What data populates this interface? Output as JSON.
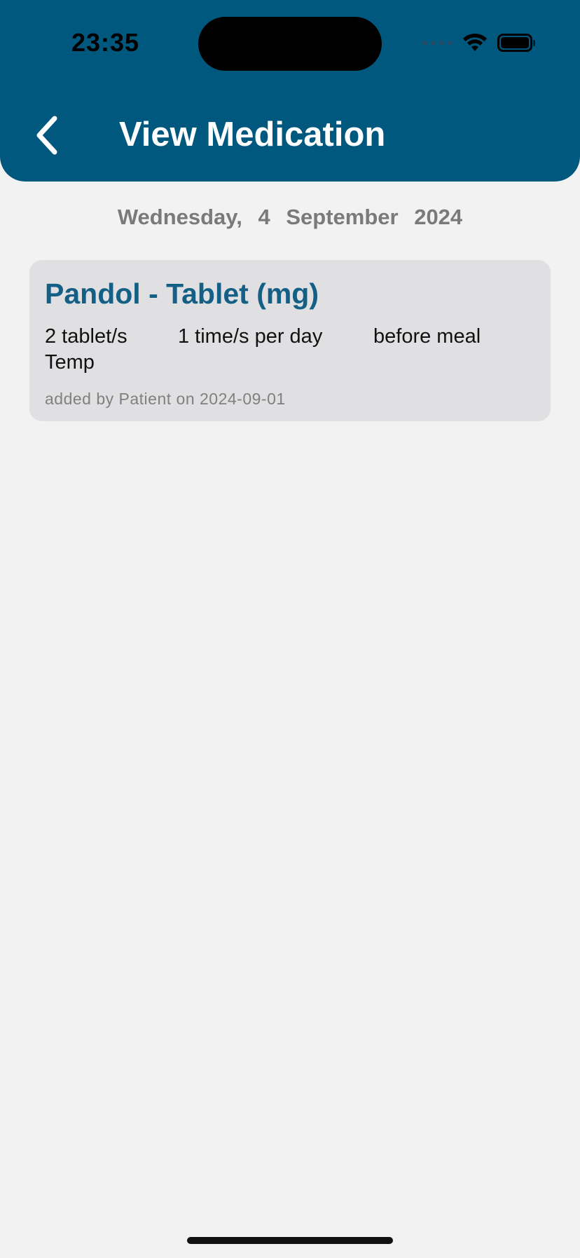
{
  "status_bar": {
    "time": "23:35"
  },
  "header": {
    "title": "View Medication",
    "back_icon": "chevron-left-icon",
    "background_color": "#01587f"
  },
  "date": {
    "weekday": "Wednesday,",
    "day": "4",
    "month": "September",
    "year": "2024"
  },
  "medications": [
    {
      "name": "Pandol - Tablet (mg)",
      "dose": "2 tablet/s",
      "frequency": "1 time/s per day",
      "timing": "before meal",
      "note": "Temp",
      "added": "added by Patient on 2024-09-01"
    }
  ],
  "colors": {
    "accent": "#135f85",
    "card_bg": "#e0e0e2",
    "page_bg": "#f2f2f2"
  }
}
